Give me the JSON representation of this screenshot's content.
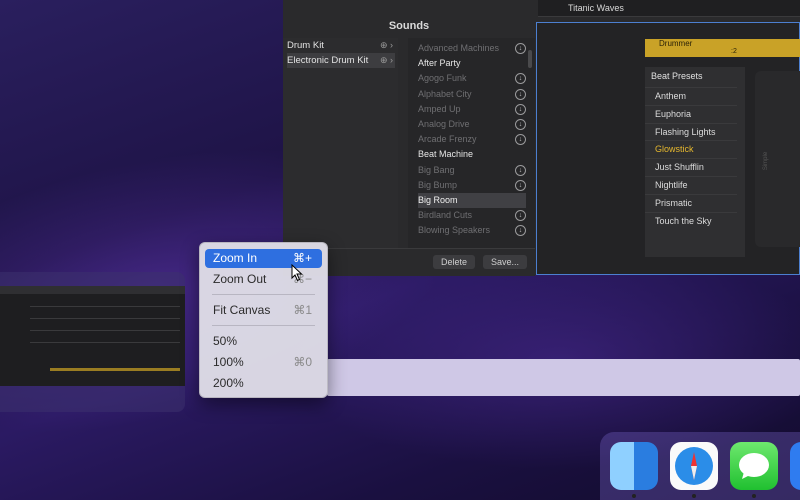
{
  "logic": {
    "track_name": "Titanic Waves",
    "sounds_title": "Sounds",
    "library": [
      {
        "label": "Drum Kit"
      },
      {
        "label": "Electronic Drum Kit"
      }
    ],
    "patches": [
      {
        "label": "Advanced Machines",
        "style": "dim",
        "download": true
      },
      {
        "label": "After Party",
        "style": "bright",
        "download": false
      },
      {
        "label": "Agogo Funk",
        "style": "dim",
        "download": true
      },
      {
        "label": "Alphabet City",
        "style": "dim",
        "download": true
      },
      {
        "label": "Amped Up",
        "style": "dim",
        "download": true
      },
      {
        "label": "Analog Drive",
        "style": "dim",
        "download": true
      },
      {
        "label": "Arcade Frenzy",
        "style": "dim",
        "download": true
      },
      {
        "label": "Beat Machine",
        "style": "bright",
        "download": false
      },
      {
        "label": "Big Bang",
        "style": "dim",
        "download": true
      },
      {
        "label": "Big Bump",
        "style": "dim",
        "download": true
      },
      {
        "label": "Big Room",
        "style": "selected",
        "download": false
      },
      {
        "label": "Birdland Cuts",
        "style": "dim",
        "download": true
      },
      {
        "label": "Blowing Speakers",
        "style": "dim",
        "download": true
      }
    ],
    "delete_label": "Delete",
    "save_label": "Save...",
    "drummer_region": "Drummer",
    "drummer_bar": ":2",
    "beat_presets_title": "Beat Presets",
    "presets": [
      "Anthem",
      "Euphoria",
      "Flashing Lights",
      "Glowstick",
      "Just Shufflin",
      "Nightlife",
      "Prismatic",
      "Touch the Sky"
    ],
    "selected_preset": "Glowstick",
    "side_label": "Simple"
  },
  "menu": {
    "items": [
      {
        "label": "Zoom In",
        "shortcut": "⌘+",
        "highlighted": true
      },
      {
        "label": "Zoom Out",
        "shortcut": "⌘−",
        "highlighted": false
      },
      {
        "label": "Fit Canvas",
        "shortcut": "⌘1",
        "highlighted": false
      },
      {
        "label": "50%",
        "shortcut": "",
        "highlighted": false
      },
      {
        "label": "100%",
        "shortcut": "⌘0",
        "highlighted": false
      },
      {
        "label": "200%",
        "shortcut": "",
        "highlighted": false
      }
    ]
  },
  "dock": {
    "apps": [
      "finder-icon",
      "safari-icon",
      "messages-icon",
      "mail-icon"
    ]
  },
  "colors": {
    "highlight": "#2e6fe0",
    "drummer_gold": "#c9a227",
    "selected_preset": "#e6b82e"
  }
}
